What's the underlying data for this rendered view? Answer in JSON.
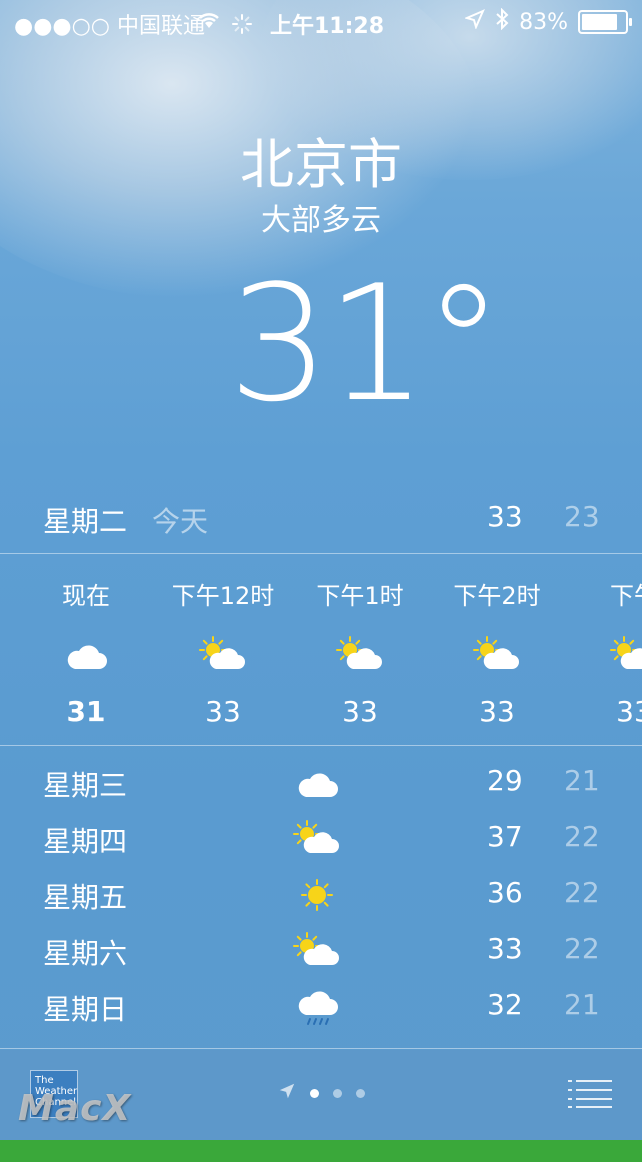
{
  "status_bar": {
    "carrier": "●●●○○ 中国联通",
    "time": "上午11:28",
    "battery": "83%",
    "battery_level": 0.83
  },
  "location": {
    "city": "北京市",
    "condition": "大部多云",
    "temperature": "31°"
  },
  "today": {
    "day": "星期二",
    "label": "今天",
    "high": "33",
    "low": "23"
  },
  "hourly": [
    {
      "time": "现在",
      "icon": "cloud-icon",
      "temp": "31"
    },
    {
      "time": "下午12时",
      "icon": "sun-cloud-icon",
      "temp": "33"
    },
    {
      "time": "下午1时",
      "icon": "sun-cloud-icon",
      "temp": "33"
    },
    {
      "time": "下午2时",
      "icon": "sun-cloud-icon",
      "temp": "33"
    },
    {
      "time": "下午",
      "icon": "sun-cloud-icon",
      "temp": "33"
    }
  ],
  "daily": [
    {
      "day": "星期三",
      "icon": "cloud-icon",
      "high": "29",
      "low": "21"
    },
    {
      "day": "星期四",
      "icon": "sun-cloud-icon",
      "high": "37",
      "low": "22"
    },
    {
      "day": "星期五",
      "icon": "sun-icon",
      "high": "36",
      "low": "22"
    },
    {
      "day": "星期六",
      "icon": "sun-cloud-icon",
      "high": "33",
      "low": "22"
    },
    {
      "day": "星期日",
      "icon": "rain-cloud-icon",
      "high": "32",
      "low": "21"
    }
  ],
  "footer": {
    "logo_text": "The Weather Channel",
    "watermark": "MacX"
  },
  "colors": {
    "sky_top": "#7fb3dc",
    "sky_bottom": "#5b9bce",
    "sun": "#f7d419",
    "frame_green": "#3aa83a"
  }
}
